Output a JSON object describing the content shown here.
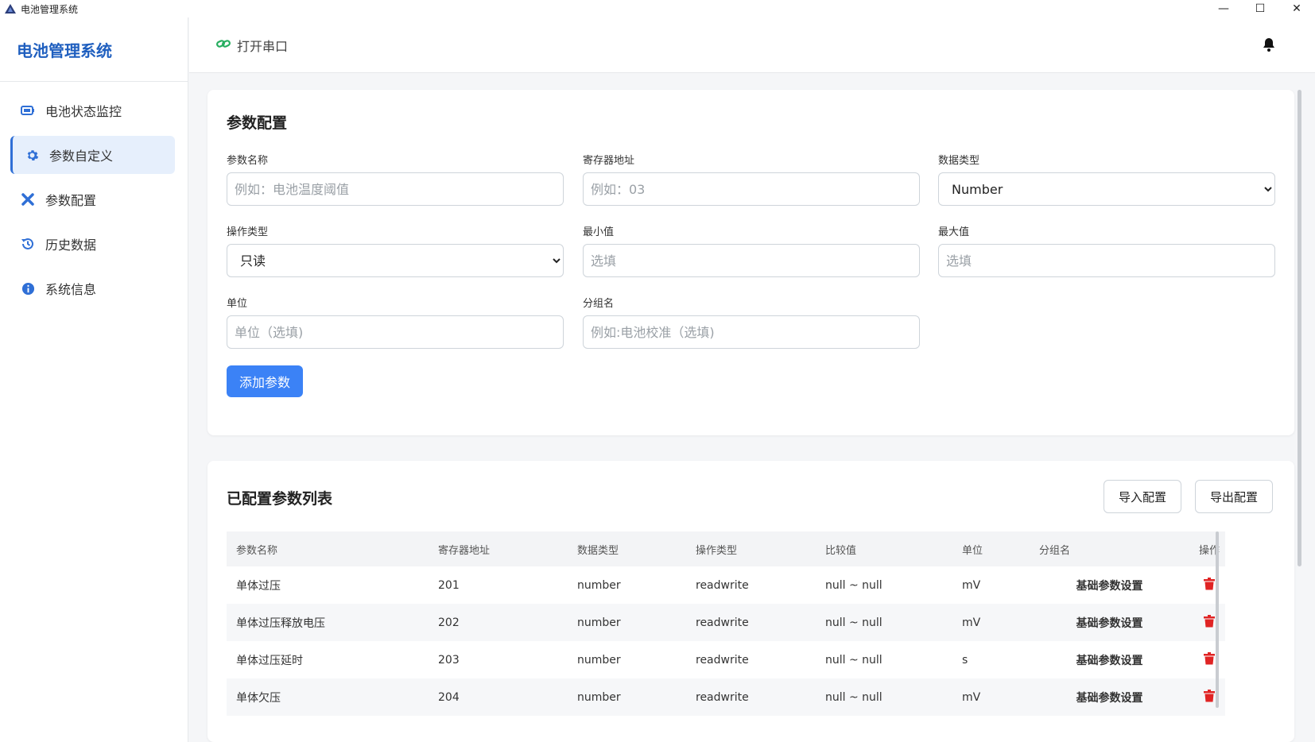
{
  "window": {
    "title": "电池管理系统",
    "minimize": "—",
    "maximize": "☐",
    "close": "✕"
  },
  "sidebar": {
    "brand": "电池管理系统",
    "items": [
      {
        "label": "电池状态监控",
        "icon": "battery-icon"
      },
      {
        "label": "参数自定义",
        "icon": "gear-icon",
        "active": true
      },
      {
        "label": "参数配置",
        "icon": "tools-icon"
      },
      {
        "label": "历史数据",
        "icon": "history-icon"
      },
      {
        "label": "系统信息",
        "icon": "info-icon"
      }
    ]
  },
  "header": {
    "serial_label": "打开串口"
  },
  "config_form": {
    "title": "参数配置",
    "fields": {
      "name": {
        "label": "参数名称",
        "placeholder": "例如：电池温度阈值"
      },
      "address": {
        "label": "寄存器地址",
        "placeholder": "例如：03"
      },
      "data_type": {
        "label": "数据类型",
        "value": "Number"
      },
      "op_type": {
        "label": "操作类型",
        "value": "只读"
      },
      "min": {
        "label": "最小值",
        "placeholder": "选填"
      },
      "max": {
        "label": "最大值",
        "placeholder": "选填"
      },
      "unit": {
        "label": "单位",
        "placeholder": "单位（选填)"
      },
      "group": {
        "label": "分组名",
        "placeholder": "例如:电池校准（选填)"
      }
    },
    "add_button": "添加参数"
  },
  "param_list": {
    "title": "已配置参数列表",
    "import_button": "导入配置",
    "export_button": "导出配置",
    "columns": [
      "参数名称",
      "寄存器地址",
      "数据类型",
      "操作类型",
      "比较值",
      "单位",
      "分组名",
      "操作"
    ],
    "rows": [
      {
        "name": "单体过压",
        "address": "201",
        "type": "number",
        "op": "readwrite",
        "range": "null ~ null",
        "unit": "mV",
        "group": "基础参数设置"
      },
      {
        "name": "单体过压释放电压",
        "address": "202",
        "type": "number",
        "op": "readwrite",
        "range": "null ~ null",
        "unit": "mV",
        "group": "基础参数设置"
      },
      {
        "name": "单体过压延时",
        "address": "203",
        "type": "number",
        "op": "readwrite",
        "range": "null ~ null",
        "unit": "s",
        "group": "基础参数设置"
      },
      {
        "name": "单体欠压",
        "address": "204",
        "type": "number",
        "op": "readwrite",
        "range": "null ~ null",
        "unit": "mV",
        "group": "基础参数设置"
      }
    ]
  },
  "colors": {
    "accent": "#3b82f6",
    "brand": "#1f5fbf",
    "danger": "#e02424",
    "link_green": "#27ae60"
  }
}
